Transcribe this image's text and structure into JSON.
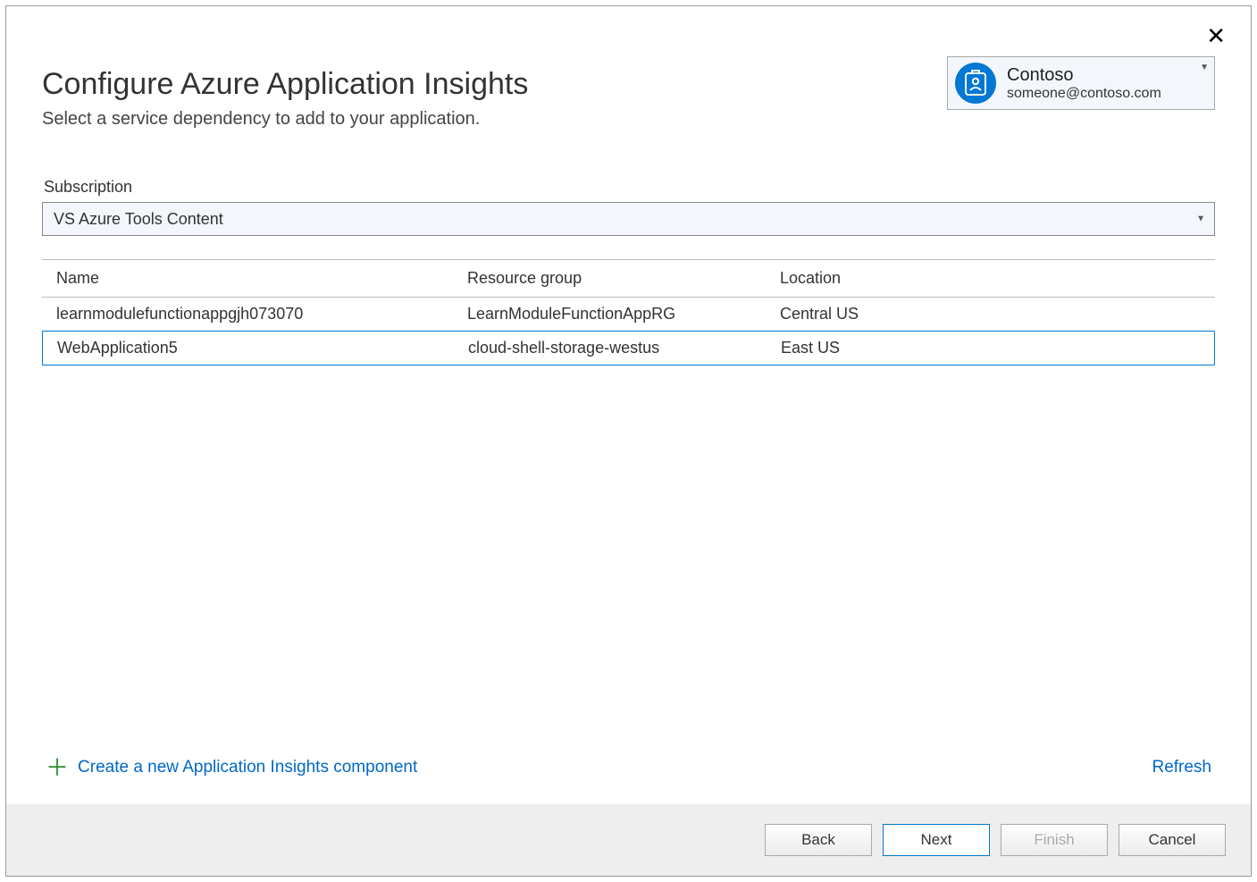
{
  "dialog": {
    "title": "Configure Azure Application Insights",
    "subtitle": "Select a service dependency to add to your application."
  },
  "account": {
    "name": "Contoso",
    "email": "someone@contoso.com"
  },
  "subscription": {
    "label": "Subscription",
    "selected": "VS Azure Tools Content"
  },
  "table": {
    "columns": {
      "name": "Name",
      "rg": "Resource group",
      "loc": "Location"
    },
    "rows": [
      {
        "name": "learnmodulefunctionappgjh073070",
        "rg": "LearnModuleFunctionAppRG",
        "loc": "Central US",
        "selected": false
      },
      {
        "name": "WebApplication5",
        "rg": "cloud-shell-storage-westus",
        "loc": "East US",
        "selected": true
      }
    ]
  },
  "links": {
    "create": "Create a new Application Insights component",
    "refresh": "Refresh"
  },
  "buttons": {
    "back": "Back",
    "next": "Next",
    "finish": "Finish",
    "cancel": "Cancel"
  }
}
